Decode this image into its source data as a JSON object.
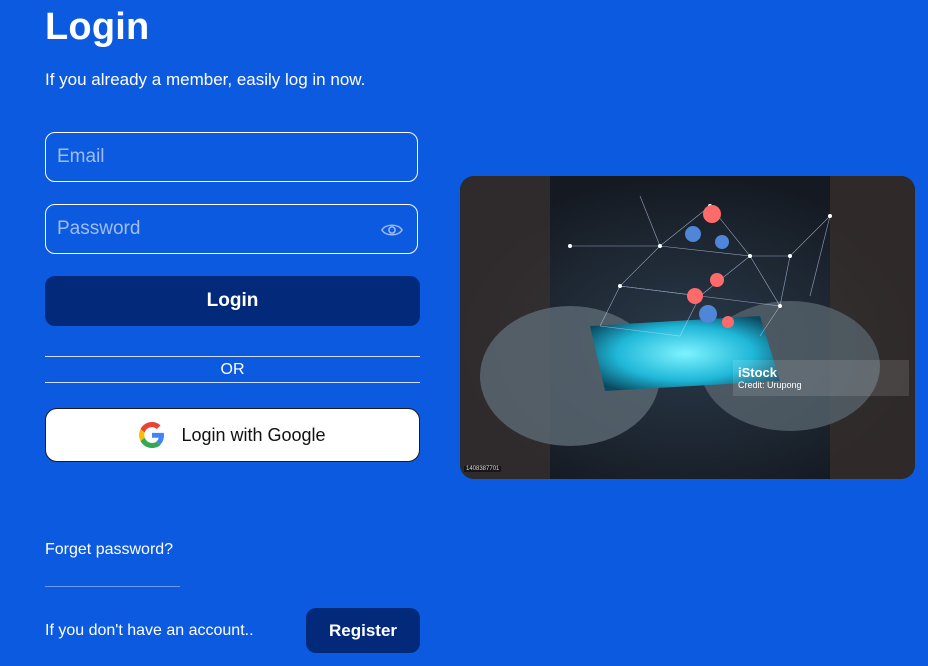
{
  "header": {
    "title": "Login",
    "subtitle": "If you already a member, easily log in now."
  },
  "form": {
    "email_placeholder": "Email",
    "email_value": "",
    "password_placeholder": "Password",
    "password_value": "",
    "password_toggle_icon": "eye-icon",
    "login_label": "Login",
    "or_label": "OR",
    "google_label": "Login with Google",
    "google_icon": "google-icon"
  },
  "image": {
    "brand": "iStock",
    "credit": "Credit: Urupong",
    "id_text": "1408387701"
  },
  "footer": {
    "forget_label": "Forget password?",
    "no_account_text": "If you don't have an account..",
    "register_label": "Register"
  },
  "colors": {
    "background": "#0b5ae0",
    "button_dark": "#032a7a",
    "text": "#ffffff"
  }
}
